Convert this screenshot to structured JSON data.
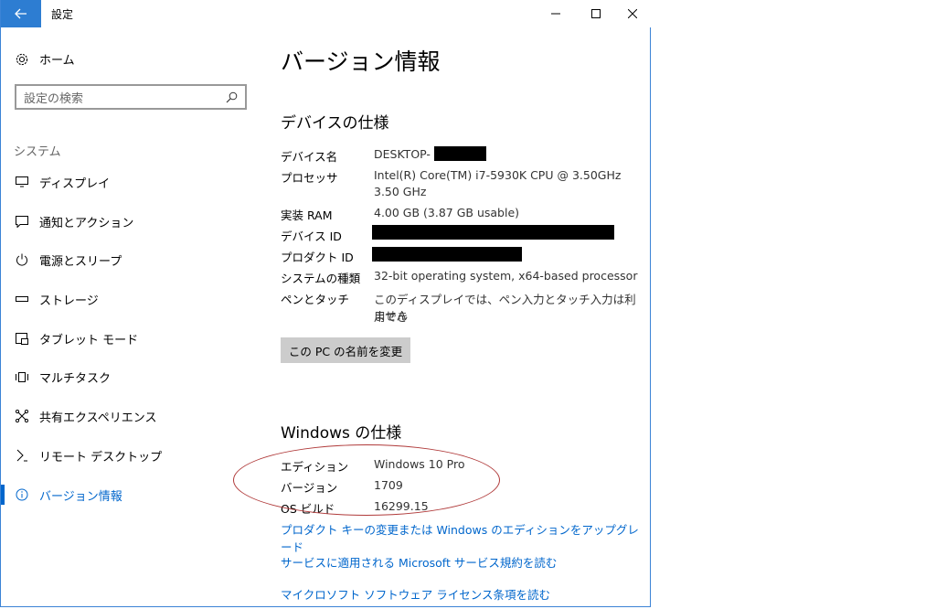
{
  "window": {
    "title": "設定"
  },
  "sidebar": {
    "home_label": "ホーム",
    "search_placeholder": "設定の検索",
    "section_label": "システム",
    "items": [
      {
        "label": "ディスプレイ",
        "icon": "monitor-icon"
      },
      {
        "label": "通知とアクション",
        "icon": "notification-icon"
      },
      {
        "label": "電源とスリープ",
        "icon": "power-icon"
      },
      {
        "label": "ストレージ",
        "icon": "storage-icon"
      },
      {
        "label": "タブレット モード",
        "icon": "tablet-icon"
      },
      {
        "label": "マルチタスク",
        "icon": "multitask-icon"
      },
      {
        "label": "共有エクスペリエンス",
        "icon": "share-icon"
      },
      {
        "label": "リモート デスクトップ",
        "icon": "remote-icon"
      },
      {
        "label": "バージョン情報",
        "icon": "info-icon",
        "active": true
      }
    ]
  },
  "main": {
    "title": "バージョン情報",
    "device_spec": {
      "heading": "デバイスの仕様",
      "rows": [
        {
          "label": "デバイス名",
          "value": "DESKTOP-"
        },
        {
          "label": "プロセッサ",
          "value": "Intel(R) Core(TM) i7-5930K CPU @ 3.50GHz",
          "value2": "3.50 GHz"
        },
        {
          "label": "実装 RAM",
          "value": "4.00 GB (3.87 GB usable)"
        },
        {
          "label": "デバイス ID",
          "value": ""
        },
        {
          "label": "プロダクト ID",
          "value": ""
        },
        {
          "label": "システムの種類",
          "value": "32-bit operating system, x64-based processor"
        },
        {
          "label": "ペンとタッチ",
          "value": "このディスプレイでは、ペン入力とタッチ入力は利用でき",
          "value2": "ません"
        }
      ],
      "rename_button": "この PC の名前を変更"
    },
    "windows_spec": {
      "heading": "Windows の仕様",
      "rows": [
        {
          "label": "エディション",
          "value": "Windows 10 Pro"
        },
        {
          "label": "バージョン",
          "value": "1709"
        },
        {
          "label": "OS ビルド",
          "value": "16299.15"
        }
      ]
    },
    "links": [
      "プロダクト キーの変更または Windows のエディションをアップグレード",
      "サービスに適用される Microsoft サービス規約を読む",
      "マイクロソフト ソフトウェア ライセンス条項を読む"
    ]
  },
  "colors": {
    "accent": "#0066cc",
    "titlebar_back": "#2d7dd2",
    "annotation": "#b03a3a"
  }
}
